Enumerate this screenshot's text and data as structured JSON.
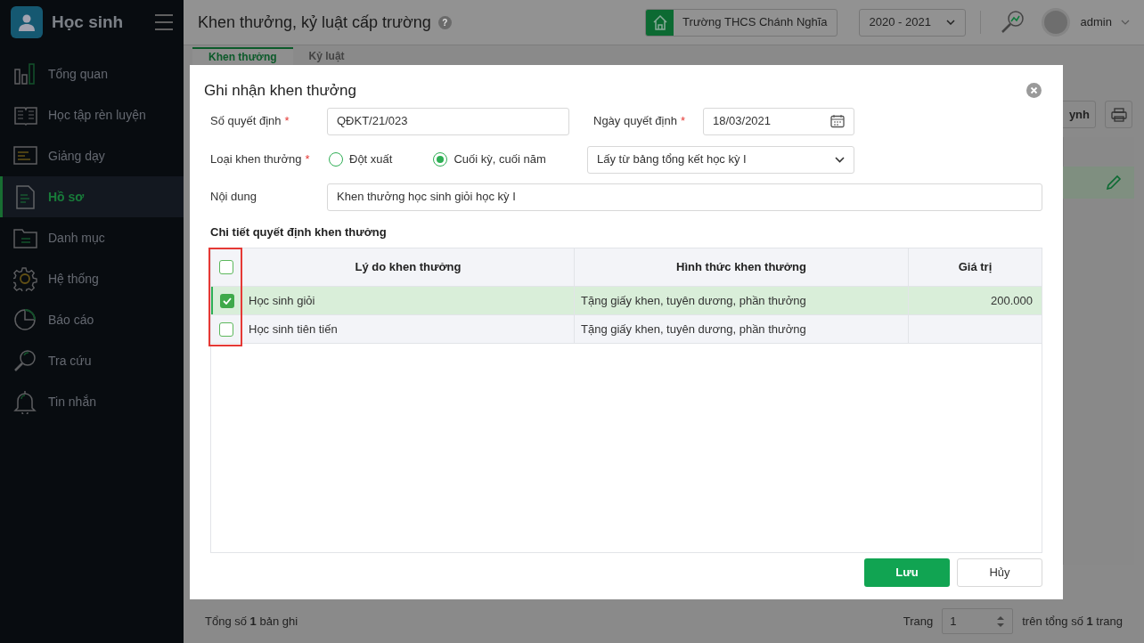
{
  "sidebar": {
    "title": "Học sinh",
    "items": [
      {
        "label": "Tổng quan",
        "selected": false
      },
      {
        "label": "Học tập rèn luyện",
        "selected": false
      },
      {
        "label": "Giảng dạy",
        "selected": false
      },
      {
        "label": "Hồ sơ",
        "selected": true
      },
      {
        "label": "Danh mục",
        "selected": false
      },
      {
        "label": "Hệ thống",
        "selected": false
      },
      {
        "label": "Báo cáo",
        "selected": false
      },
      {
        "label": "Tra cứu",
        "selected": false
      },
      {
        "label": "Tin nhắn",
        "selected": false
      }
    ]
  },
  "header": {
    "title": "Khen thưởng, kỷ luật cấp trường",
    "help": "?",
    "school": "Trường THCS Chánh Nghĩa",
    "year": "2020 - 2021",
    "user": "admin"
  },
  "page_tabs": [
    {
      "label": "Khen thưởng",
      "selected": true
    },
    {
      "label": "Kỷ luật",
      "selected": false
    }
  ],
  "toolbar_button": "ynh",
  "footer": {
    "total": "Tổng số **1** bản ghi",
    "page_label": "Trang",
    "page": "1",
    "page_total": "trên tổng số **1** trang"
  },
  "dialog": {
    "title": "Ghi nhận khen thưởng",
    "decision_number": {
      "label": "Số quyết định",
      "required_mark": "*",
      "value": "QĐKT/21/023"
    },
    "decision_date": {
      "label": "Ngày quyết định",
      "required_mark": "*",
      "value": "18/03/2021"
    },
    "reward_type": {
      "label": "Loại khen thưởng",
      "required_mark": "*",
      "options": [
        {
          "label": "Đột xuất",
          "selected": false
        },
        {
          "label": "Cuối kỳ, cuối năm",
          "selected": true
        }
      ],
      "source": "Lấy từ bảng tổng kết học kỳ I"
    },
    "content": {
      "label": "Nội dung",
      "value": "Khen thưởng học sinh giỏi học kỳ I"
    },
    "section_title": "Chi tiết quyết định khen thưởng",
    "table": {
      "all_checked": false,
      "columns": [
        "Lý do khen thưởng",
        "Hình thức khen thưởng",
        "Giá trị"
      ],
      "rows": [
        {
          "checked": true,
          "cells": [
            "Học sinh giỏi",
            "Tặng giấy khen, tuyên dương, phần thưởng",
            "200.000"
          ]
        },
        {
          "checked": false,
          "cells": [
            "Học sinh tiên tiến",
            "Tặng giấy khen, tuyên dương, phần thưởng",
            ""
          ]
        }
      ]
    },
    "buttons": {
      "save": "Lưu",
      "cancel": "Hủy"
    }
  }
}
